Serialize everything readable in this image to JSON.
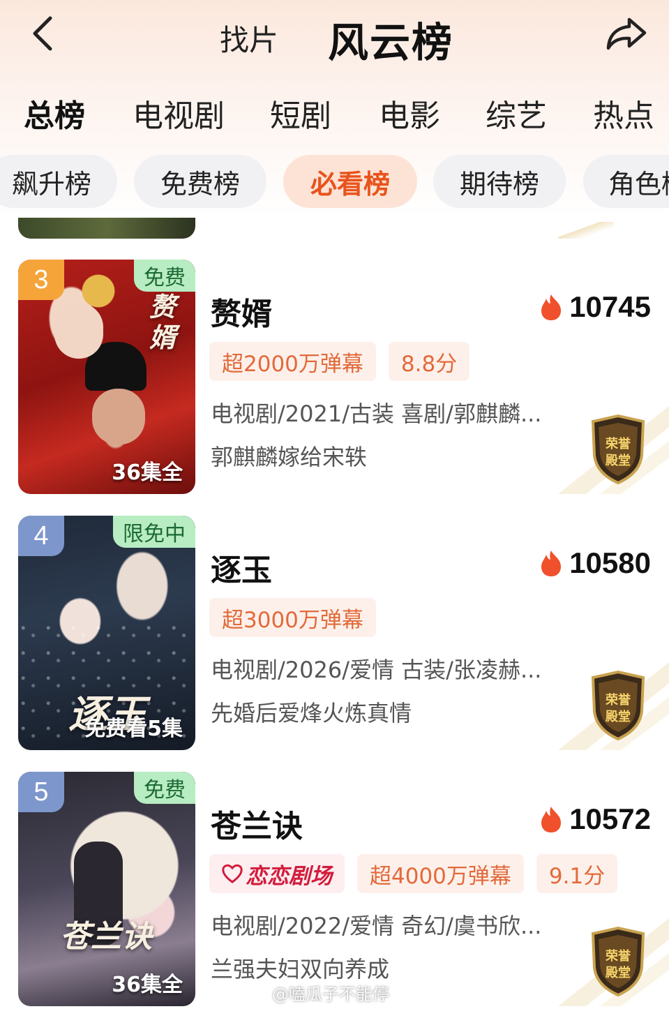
{
  "header": {
    "find_label": "找片",
    "title": "风云榜"
  },
  "category_tabs": [
    {
      "label": "总榜",
      "active": true
    },
    {
      "label": "电视剧",
      "active": false
    },
    {
      "label": "短剧",
      "active": false
    },
    {
      "label": "电影",
      "active": false
    },
    {
      "label": "综艺",
      "active": false
    },
    {
      "label": "热点",
      "active": false
    }
  ],
  "sub_tabs": [
    {
      "label": "飙升榜",
      "active": false
    },
    {
      "label": "免费榜",
      "active": false
    },
    {
      "label": "必看榜",
      "active": true
    },
    {
      "label": "期待榜",
      "active": false
    },
    {
      "label": "角色榜",
      "active": false
    }
  ],
  "items": [
    {
      "rank": "3",
      "title": "赘婿",
      "heat": "10745",
      "free_tag": "免费",
      "poster_text": "36集全",
      "poster_calligraphy": "赘婿",
      "tags": [
        "超2000万弹幕",
        "8.8分"
      ],
      "meta": "电视剧/2021/古装 喜剧/郭麒麟...",
      "desc": "郭麒麟嫁给宋轶",
      "badge": "荣誉殿堂"
    },
    {
      "rank": "4",
      "title": "逐玉",
      "heat": "10580",
      "free_tag": "限免中",
      "poster_text": "免费看5集",
      "poster_calligraphy": "逐玉",
      "tags": [
        "超3000万弹幕"
      ],
      "meta": "电视剧/2026/爱情 古装/张凌赫...",
      "desc": "先婚后爱烽火炼真情",
      "badge": "荣誉殿堂"
    },
    {
      "rank": "5",
      "title": "苍兰诀",
      "heat": "10572",
      "free_tag": "免费",
      "poster_text": "36集全",
      "poster_calligraphy": "苍兰诀",
      "logo_tag": "恋恋剧场",
      "tags": [
        "超4000万弹幕",
        "9.1分"
      ],
      "meta": "电视剧/2022/爱情 奇幻/虞书欣...",
      "desc": "兰强夫妇双向养成",
      "badge": "荣誉殿堂"
    }
  ],
  "watermark": "@嗑瓜子不能停",
  "colors": {
    "accent": "#e8531c",
    "tag_text": "#e26a3b",
    "free_tag_bg": "#b8ecc2",
    "heat_flame": "#f0502c"
  }
}
